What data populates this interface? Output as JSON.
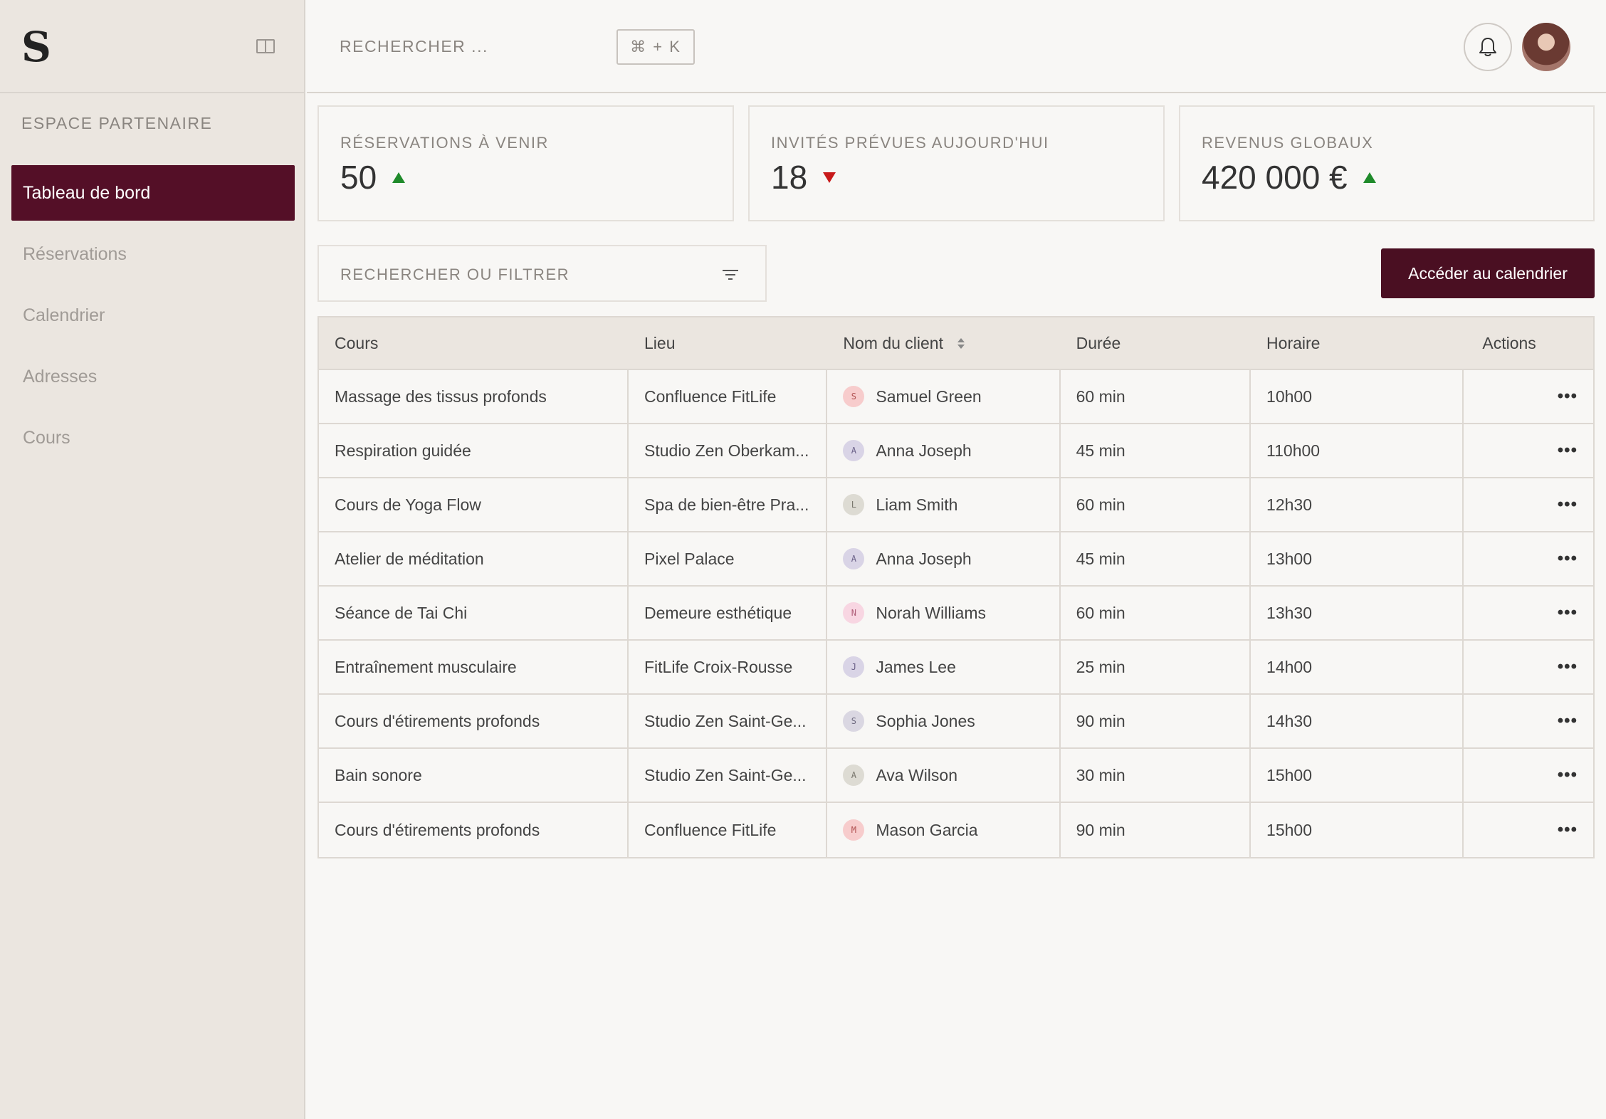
{
  "sidebar": {
    "logo": "S",
    "section_label": "ESPACE PARTENAIRE",
    "items": [
      {
        "label": "Tableau de bord",
        "active": true
      },
      {
        "label": "Réservations",
        "active": false
      },
      {
        "label": "Calendrier",
        "active": false
      },
      {
        "label": "Adresses",
        "active": false
      },
      {
        "label": "Cours",
        "active": false
      }
    ]
  },
  "header": {
    "search_placeholder": "RECHERCHER ...",
    "shortcut": "⌘ + K"
  },
  "stats": [
    {
      "label": "RÉSERVATIONS À VENIR",
      "value": "50",
      "trend": "up"
    },
    {
      "label": "INVITÉS PRÉVUES AUJOURD'HUI",
      "value": "18",
      "trend": "down"
    },
    {
      "label": "REVENUS GLOBAUX",
      "value": "420 000 €",
      "trend": "up"
    }
  ],
  "filter": {
    "placeholder": "RECHERCHER OU FILTRER"
  },
  "calendar_button": "Accéder au calendrier",
  "table": {
    "headers": [
      "Cours",
      "Lieu",
      "Nom du client",
      "Durée",
      "Horaire",
      "Actions"
    ],
    "rows": [
      {
        "cours": "Massage des tissus profonds",
        "lieu": "Confluence FitLife",
        "initial": "S",
        "client": "Samuel Green",
        "duree": "60 min",
        "horaire": "10h00",
        "avatar_bg": "#f7cccc",
        "avatar_fg": "#b05050"
      },
      {
        "cours": "Respiration guidée",
        "lieu": "Studio Zen Oberkam...",
        "initial": "A",
        "client": "Anna Joseph",
        "duree": "45 min",
        "horaire": "110h00",
        "avatar_bg": "#d9d4e6",
        "avatar_fg": "#6a6088"
      },
      {
        "cours": "Cours de Yoga Flow",
        "lieu": "Spa de bien-être Pra...",
        "initial": "L",
        "client": "Liam Smith",
        "duree": "60 min",
        "horaire": "12h30",
        "avatar_bg": "#dddbd3",
        "avatar_fg": "#7a776e"
      },
      {
        "cours": "Atelier de méditation",
        "lieu": "Pixel Palace",
        "initial": "A",
        "client": "Anna Joseph",
        "duree": "45 min",
        "horaire": "13h00",
        "avatar_bg": "#d9d4e6",
        "avatar_fg": "#6a6088"
      },
      {
        "cours": "Séance de Tai Chi",
        "lieu": "Demeure esthétique",
        "initial": "N",
        "client": "Norah Williams",
        "duree": "60 min",
        "horaire": "13h30",
        "avatar_bg": "#f8d6e2",
        "avatar_fg": "#b0607a"
      },
      {
        "cours": "Entraînement musculaire",
        "lieu": "FitLife Croix-Rousse",
        "initial": "J",
        "client": "James Lee",
        "duree": "25 min",
        "horaire": "14h00",
        "avatar_bg": "#d9d4e6",
        "avatar_fg": "#6a6088"
      },
      {
        "cours": "Cours d'étirements profonds",
        "lieu": "Studio Zen Saint-Ge...",
        "initial": "S",
        "client": "Sophia Jones",
        "duree": "90 min",
        "horaire": "14h30",
        "avatar_bg": "#dad7e2",
        "avatar_fg": "#6f6b80"
      },
      {
        "cours": "Bain sonore",
        "lieu": "Studio Zen Saint-Ge...",
        "initial": "A",
        "client": "Ava Wilson",
        "duree": "30 min",
        "horaire": "15h00",
        "avatar_bg": "#dddbd3",
        "avatar_fg": "#7a776e"
      },
      {
        "cours": "Cours d'étirements profonds",
        "lieu": "Confluence FitLife",
        "initial": "M",
        "client": "Mason Garcia",
        "duree": "90 min",
        "horaire": "15h00",
        "avatar_bg": "#f7cccc",
        "avatar_fg": "#b05050"
      }
    ],
    "row_action": "•••"
  },
  "colors": {
    "accent": "#540f27",
    "trend_up": "#1f8a2a",
    "trend_down": "#c81a1a"
  }
}
